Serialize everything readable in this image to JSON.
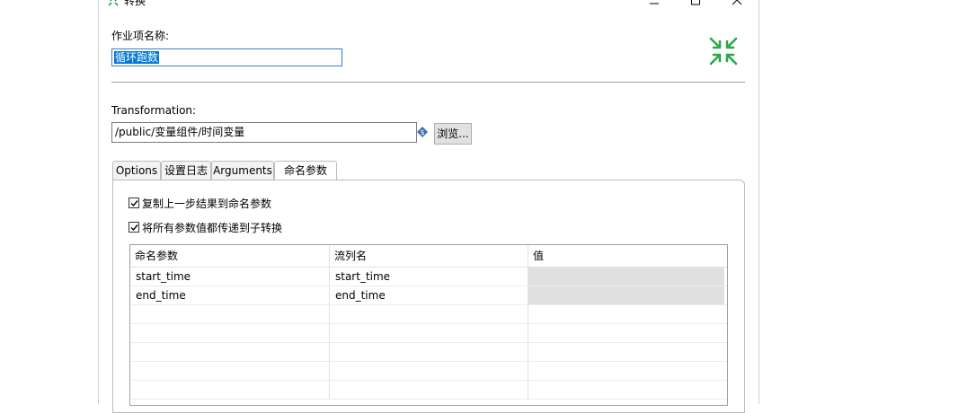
{
  "window": {
    "title": "转换"
  },
  "job": {
    "name_label": "作业项名称:",
    "name_value": "循环跑数"
  },
  "transformation": {
    "label": "Transformation:",
    "path": "/public/变量组件/时间变量",
    "browse_label": "浏览..."
  },
  "tabs": [
    {
      "label": "Options"
    },
    {
      "label": "设置日志"
    },
    {
      "label": "Arguments"
    },
    {
      "label": "命名参数"
    }
  ],
  "params": {
    "copy_results_label": "复制上一步结果到命名参数",
    "copy_results_checked": true,
    "pass_all_label": "将所有参数值都传递到子转换",
    "pass_all_checked": true,
    "columns": [
      "命名参数",
      "流列名",
      "值"
    ],
    "rows": [
      {
        "name": "start_time",
        "stream": "start_time",
        "value": ""
      },
      {
        "name": "end_time",
        "stream": "end_time",
        "value": ""
      }
    ]
  },
  "icons": {
    "app": "kettle-transform-icon",
    "big": "compress-arrows-icon",
    "variable": "variable-diamond-icon",
    "accent": "#2aa84a"
  }
}
